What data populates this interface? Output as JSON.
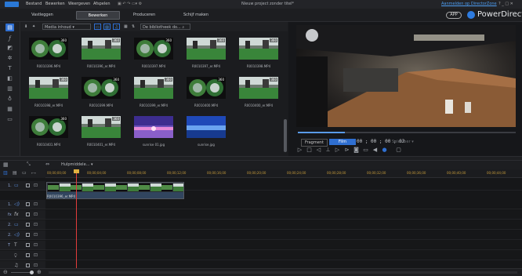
{
  "menu": {
    "items": [
      "Bestand",
      "Bewerken",
      "Weergeven",
      "Afspelen"
    ],
    "window_title": "Nieuw project zonder titel*",
    "account_link": "Aanmelden op DirectorZone",
    "window_controls": "? _ □ ✕"
  },
  "tabs": [
    {
      "label": "Vastleggen",
      "active": false
    },
    {
      "label": "Bewerken",
      "active": true
    },
    {
      "label": "Produceren",
      "active": false
    },
    {
      "label": "Schijf maken",
      "active": false
    }
  ],
  "brand": {
    "app_badge": "APP",
    "name": "PowerDirector"
  },
  "library": {
    "filter": "Media inhoud",
    "search_placeholder": "De bibliotheek do...",
    "items": [
      {
        "label": "R0010396.MP4",
        "kind": "sphere",
        "has360": true
      },
      {
        "label": "R0010396_er.MP4",
        "kind": "equirect",
        "has360": true
      },
      {
        "label": "R0010397.MP4",
        "kind": "sphere",
        "has360": true
      },
      {
        "label": "R0010397_er.MP4",
        "kind": "equirect",
        "has360": true
      },
      {
        "label": "R0010398.MP4",
        "kind": "equirect",
        "has360": true
      },
      {
        "label": "R0010398_er.MP4",
        "kind": "equirect",
        "has360": true
      },
      {
        "label": "R0010399.MP4",
        "kind": "sphere",
        "has360": true
      },
      {
        "label": "R0010399_er.MP4",
        "kind": "equirect",
        "has360": true
      },
      {
        "label": "R0010400.MP4",
        "kind": "sphere",
        "has360": true
      },
      {
        "label": "R0010400_er.MP4",
        "kind": "equirect",
        "has360": true
      },
      {
        "label": "R0010401.MP4",
        "kind": "sphere",
        "has360": true
      },
      {
        "label": "R0010401_er.MP4",
        "kind": "equirect",
        "has360": true
      },
      {
        "label": "sunrise 01.jpg",
        "kind": "sunrise",
        "has360": false
      },
      {
        "label": "sunrise.jpg",
        "kind": "blue",
        "has360": false
      }
    ],
    "badge_text": "360"
  },
  "preview": {
    "mode_fragment": "Fragment",
    "mode_film": "Film",
    "timecode": "00 ; 00 ; 00 ; 02",
    "quality": "Selecteer"
  },
  "timeline": {
    "helper": "Hulpmiddele...",
    "ticks": [
      "00;00;00;00",
      "00;00;04;00",
      "00;00;08;00",
      "00;00;12;00",
      "00;00;16;00",
      "00;00;20;00",
      "00;00;24;00",
      "00;00;28;00",
      "00;00;32;00",
      "00;00;36;00",
      "00;00;40;00",
      "00;00;44;00"
    ],
    "clip_label": "R0010396_er.MP4",
    "tracks": [
      {
        "label": "1.",
        "icon": "video-track-icon"
      },
      {
        "label": "1.",
        "icon": "audio-track-icon"
      },
      {
        "label": "fx",
        "icon": "fx-track-icon"
      },
      {
        "label": "2.",
        "icon": "video-track-icon"
      },
      {
        "label": "2.",
        "icon": "audio-track-icon"
      },
      {
        "label": "T",
        "icon": "title-track-icon"
      },
      {
        "label": "",
        "icon": "voice-track-icon"
      },
      {
        "label": "",
        "icon": "music-track-icon"
      }
    ]
  },
  "colors": {
    "accent": "#2f6fd1",
    "playhead": "#e23c3c",
    "tick": "#c49a3a"
  }
}
